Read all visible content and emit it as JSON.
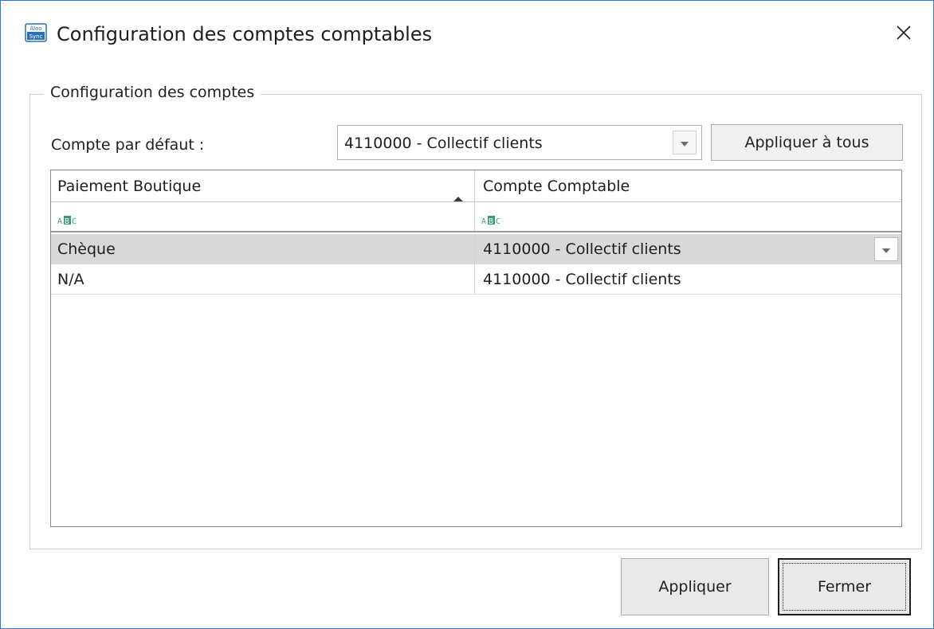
{
  "window": {
    "title": "Configuration des comptes comptables",
    "icon": "app-logo-icon",
    "close_icon": "close-icon"
  },
  "group": {
    "legend": "Configuration des comptes",
    "default_label": "Compte par défaut :",
    "default_value": "4110000 - Collectif clients",
    "apply_all_label": "Appliquer à tous"
  },
  "grid": {
    "columns": [
      "Paiement Boutique",
      "Compte Comptable"
    ],
    "sort_column": "Paiement Boutique",
    "sort_direction": "ascending",
    "rows": [
      {
        "payment": "Chèque",
        "account": "4110000 - Collectif clients",
        "selected": true
      },
      {
        "payment": "N/A",
        "account": "4110000 - Collectif clients",
        "selected": false
      }
    ]
  },
  "footer": {
    "apply_label": "Appliquer",
    "close_label": "Fermer"
  },
  "colors": {
    "window_border": "#2b79d7",
    "selected_row": "#d9d9d9",
    "abc_icon": "#3f9a72"
  }
}
